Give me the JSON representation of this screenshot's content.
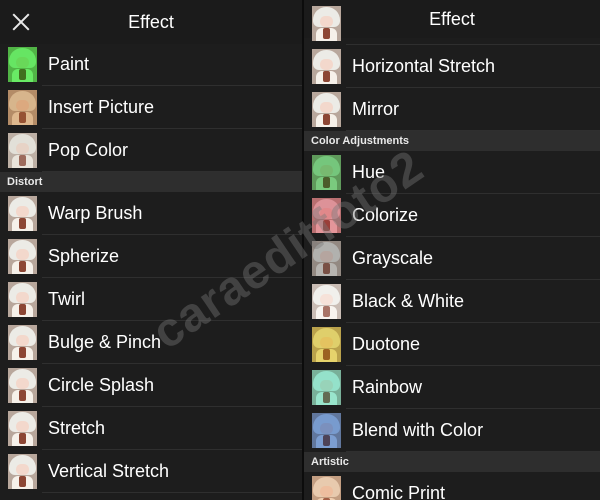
{
  "left": {
    "title": "Effect",
    "rows": [
      {
        "label": "Paint",
        "tint": "#22ee22"
      },
      {
        "label": "Insert Picture",
        "tint": "#d6a165"
      },
      {
        "label": "Pop Color",
        "tint": "#e9e6e0"
      },
      {
        "section": "Distort"
      },
      {
        "label": "Warp Brush"
      },
      {
        "label": "Spherize"
      },
      {
        "label": "Twirl"
      },
      {
        "label": "Bulge & Pinch"
      },
      {
        "label": "Circle Splash"
      },
      {
        "label": "Stretch"
      },
      {
        "label": "Vertical Stretch"
      }
    ]
  },
  "right": {
    "title": "Effect",
    "rows": [
      {
        "label": "Horizontal Stretch"
      },
      {
        "label": "Mirror"
      },
      {
        "section": "Color Adjustments"
      },
      {
        "label": "Hue",
        "tint": "#3bbd4a"
      },
      {
        "label": "Colorize",
        "tint": "#e06a78"
      },
      {
        "label": "Grayscale",
        "tint": "#9a9a9a"
      },
      {
        "label": "Black & White",
        "tint": "#ffffff"
      },
      {
        "label": "Duotone",
        "tint": "#e3cc2e"
      },
      {
        "label": "Rainbow",
        "tint": "#6ce8c8"
      },
      {
        "label": "Blend with Color",
        "tint": "#3f77cf"
      },
      {
        "section": "Artistic"
      },
      {
        "label": "Comic Print",
        "tint": "#f2c49a"
      }
    ]
  },
  "watermark": "caraeditfoto2"
}
